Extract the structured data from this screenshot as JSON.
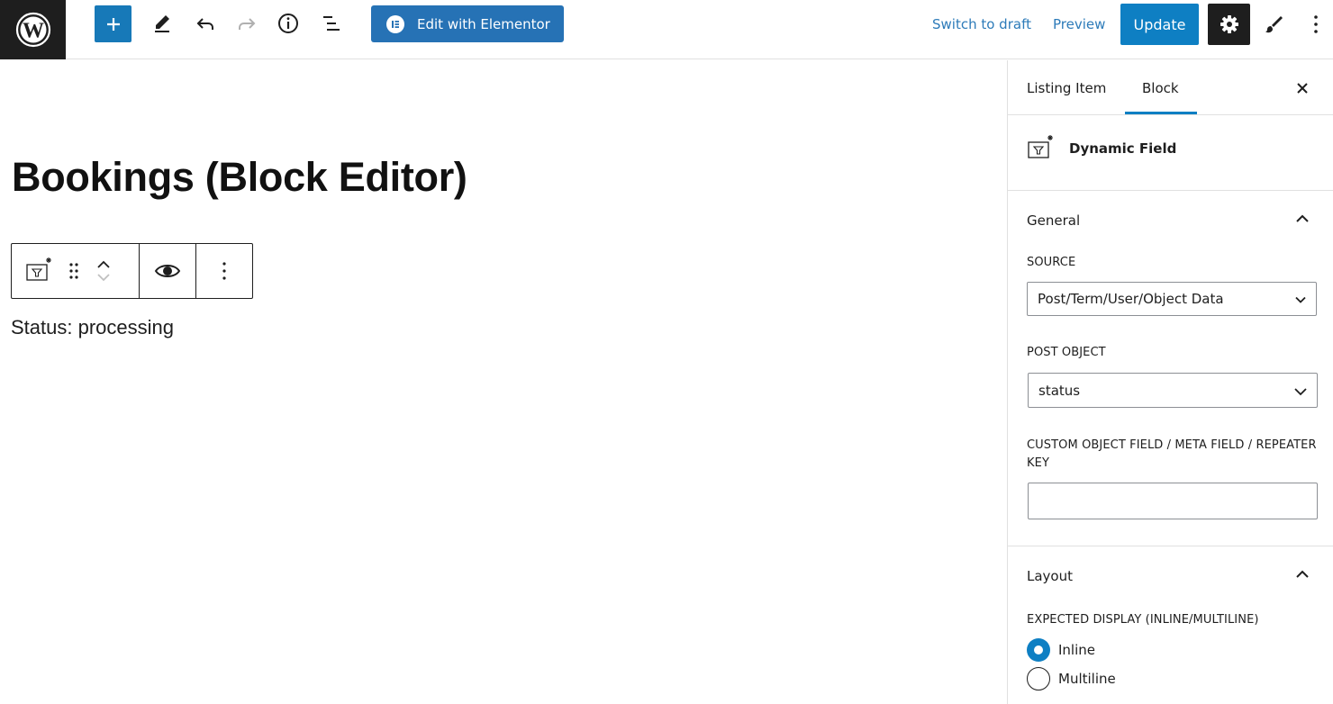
{
  "toolbar": {
    "elementor_label": "Edit with Elementor",
    "switch_to_draft": "Switch to draft",
    "preview": "Preview",
    "update": "Update",
    "icons": [
      "wordpress-logo-icon",
      "plus-icon",
      "pencil-icon",
      "undo-icon",
      "redo-icon",
      "info-icon",
      "list-view-icon",
      "elementor-icon",
      "gear-icon",
      "brush-icon",
      "more-vertical-icon"
    ]
  },
  "canvas": {
    "title": "Bookings (Block Editor)",
    "status_text": "Status: processing"
  },
  "sidebar": {
    "tabs": [
      {
        "label": "Listing Item"
      },
      {
        "label": "Block",
        "active": true
      }
    ],
    "block": {
      "name": "Dynamic Field"
    },
    "general": {
      "title": "General",
      "source_label": "SOURCE",
      "source_value": "Post/Term/User/Object Data",
      "post_object_label": "POST OBJECT",
      "post_object_value": "status",
      "custom_field_label": "CUSTOM OBJECT FIELD / META FIELD / REPEATER KEY",
      "custom_field_value": ""
    },
    "layout": {
      "title": "Layout",
      "display_label": "EXPECTED DISPLAY (INLINE/MULTILINE)",
      "options": [
        {
          "label": "Inline",
          "checked": true
        },
        {
          "label": "Multiline",
          "checked": false
        }
      ]
    }
  },
  "colors": {
    "accent": "#0e7fc3",
    "elementor": "#2672b5",
    "dark": "#1e1e1e"
  }
}
